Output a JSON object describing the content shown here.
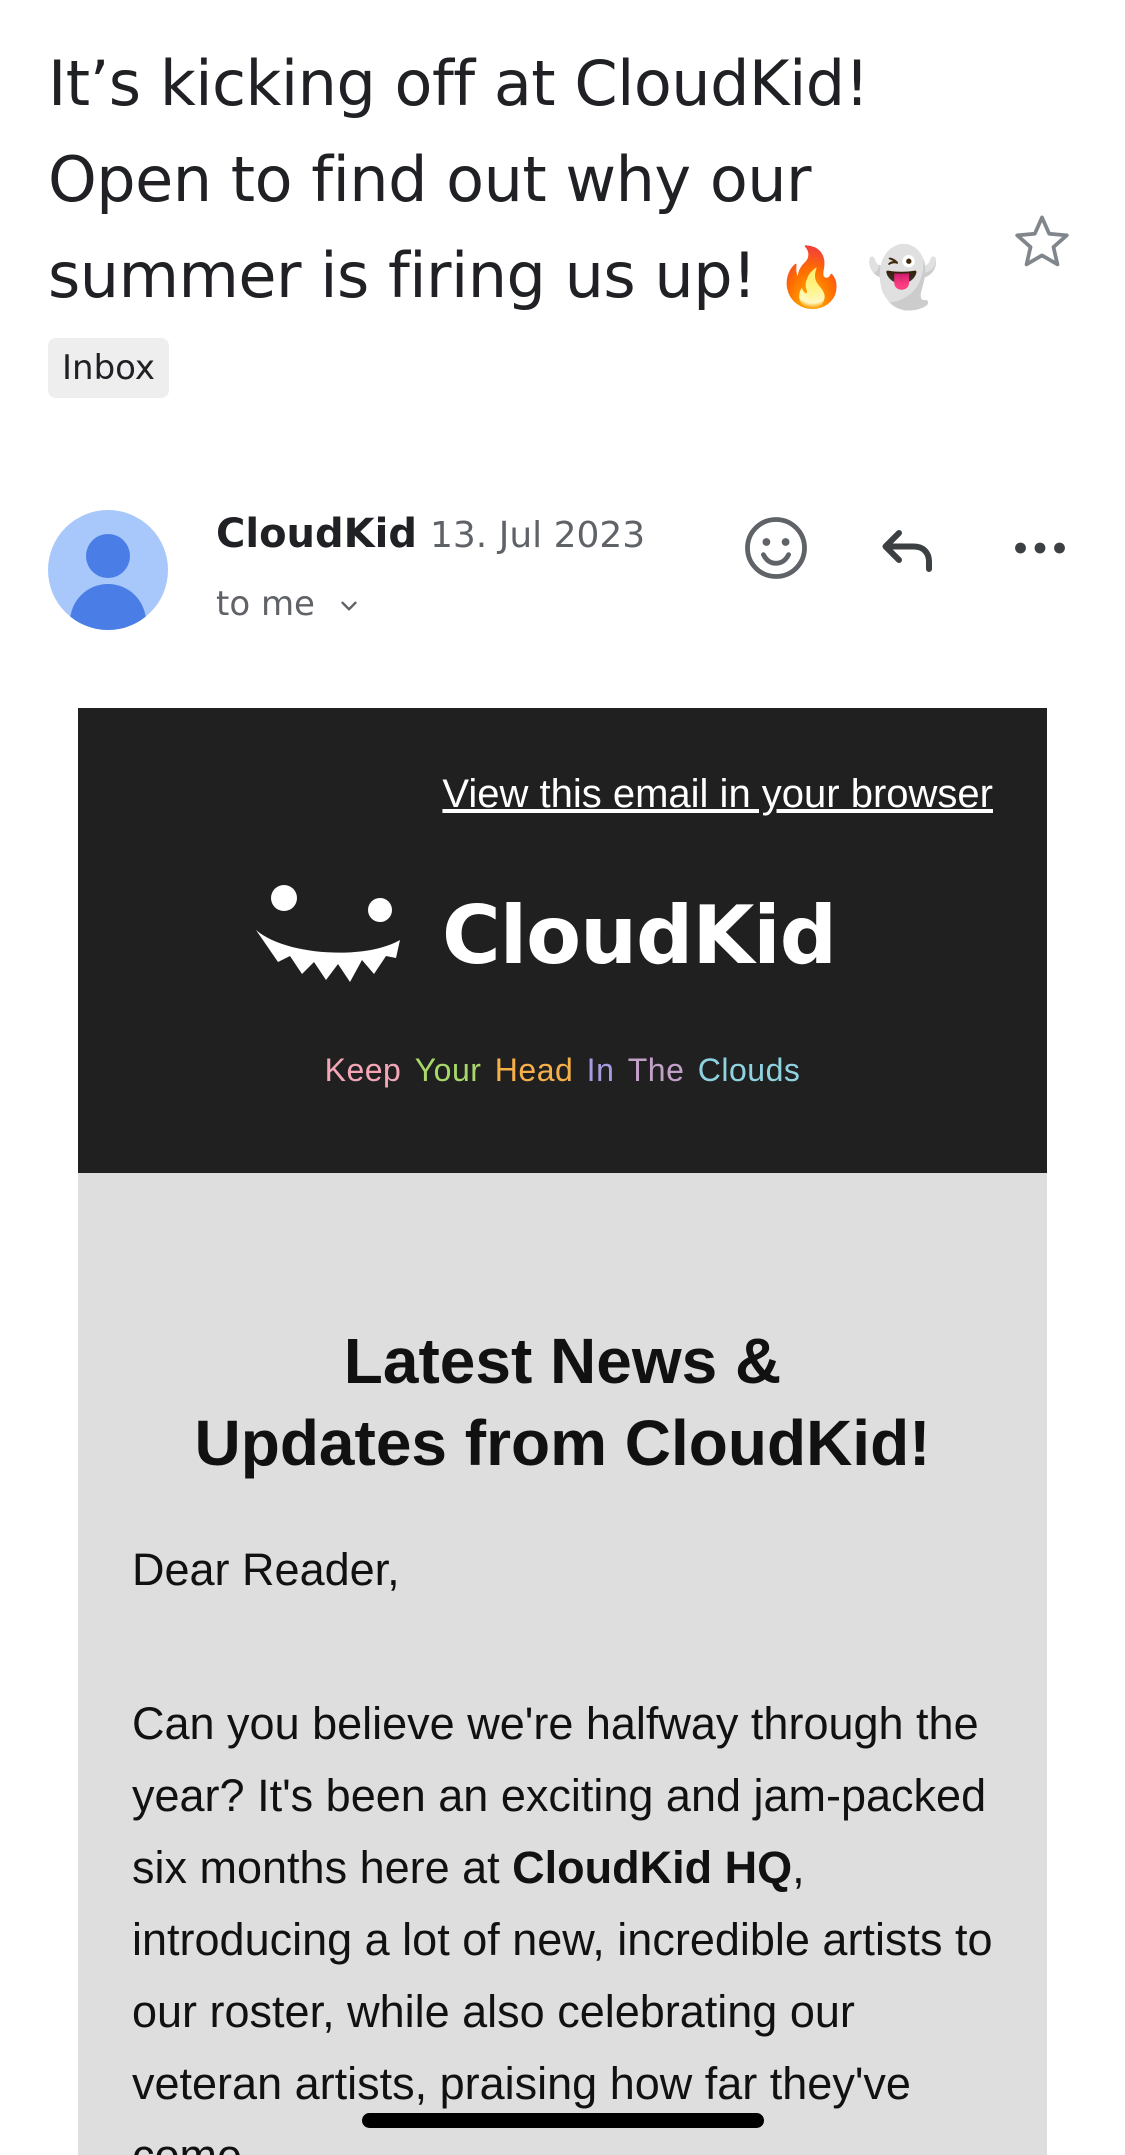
{
  "subject": {
    "line1": "It’s kicking off at CloudKid!",
    "line2": "Open to find out why our",
    "line3": "summer is firing us up!",
    "emoji1": "🔥",
    "emoji2": "👻"
  },
  "label": "Inbox",
  "sender": {
    "name": "CloudKid",
    "date": "13. Jul 2023",
    "recipient": "to me"
  },
  "icons": {
    "star": "star-outline-icon",
    "emoji_react": "smiley-icon",
    "reply": "reply-arrow-icon",
    "more": "more-horizontal-icon",
    "chevron": "chevron-down-icon"
  },
  "email": {
    "view_in_browser": "View this email in your browser",
    "brand": "CloudKid",
    "tagline": [
      {
        "word": "Keep",
        "color": "#f4a6b6"
      },
      {
        "word": "Your",
        "color": "#a8d86a"
      },
      {
        "word": "Head",
        "color": "#f6b04a"
      },
      {
        "word": "In",
        "color": "#a99be0"
      },
      {
        "word": "The",
        "color": "#c3a0c8"
      },
      {
        "word": "Clouds",
        "color": "#8fd3e0"
      }
    ],
    "headline_line1": "Latest News &",
    "headline_line2": "Updates from CloudKid!",
    "greeting": "Dear Reader,",
    "para_part1": "Can you believe we're halfway through the year? It's been an exciting and jam-packed six months here at ",
    "para_bold": "CloudKid HQ",
    "para_part2": ", introducing a lot of new, incredible artists to our roster, while also celebrating our veteran artists, praising how far they've come."
  },
  "colors": {
    "banner_bg": "#202020",
    "panel_bg": "#dedede",
    "avatar_bg": "#a8c7fa",
    "avatar_fg": "#4a7de6"
  }
}
